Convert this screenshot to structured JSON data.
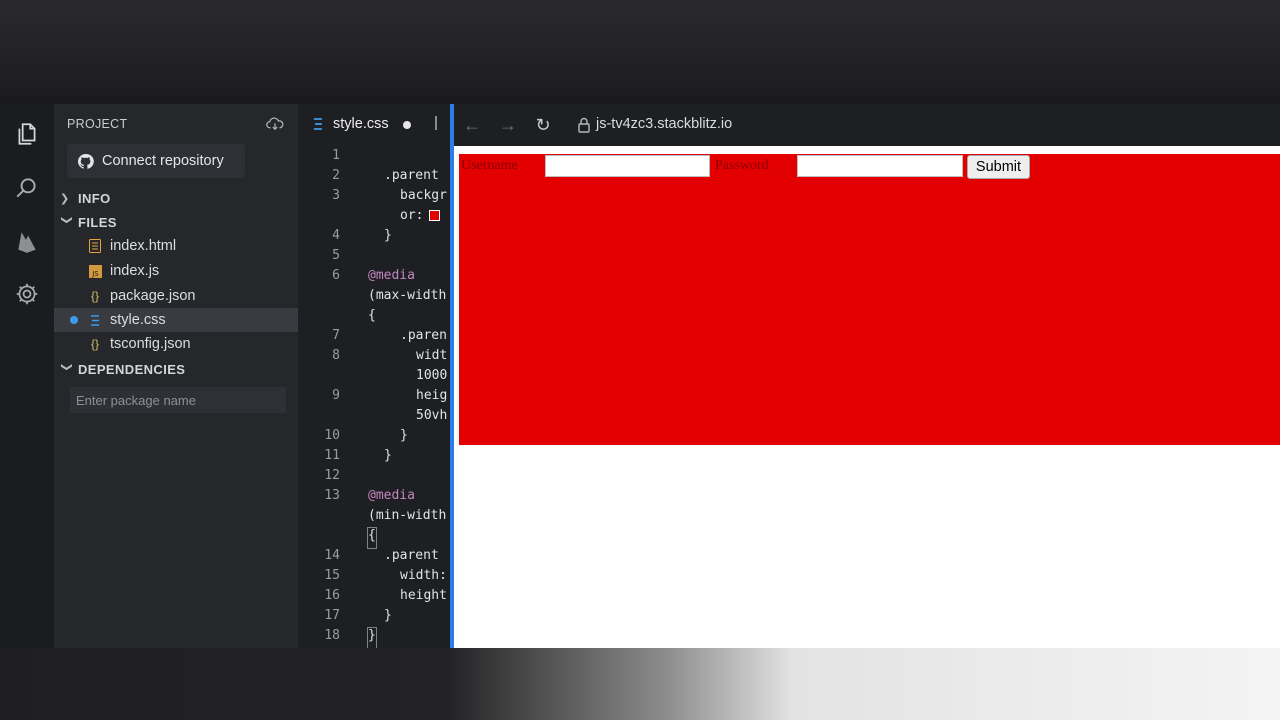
{
  "sidebar": {
    "project_title": "PROJECT",
    "connect_label": "Connect repository",
    "sections": {
      "info": "INFO",
      "files": "FILES",
      "dependencies": "DEPENDENCIES"
    },
    "files": [
      {
        "name": "index.html",
        "icon": "html-file-icon"
      },
      {
        "name": "index.js",
        "icon": "js-file-icon"
      },
      {
        "name": "package.json",
        "icon": "json-file-icon"
      },
      {
        "name": "style.css",
        "icon": "css-file-icon",
        "active": true,
        "unsaved": true
      },
      {
        "name": "tsconfig.json",
        "icon": "json-file-icon"
      }
    ],
    "package_placeholder": "Enter package name"
  },
  "editor": {
    "tab_label": "style.css",
    "line_numbers": [
      "1",
      "2",
      "3",
      "4",
      "5",
      "6",
      "7",
      "8",
      "9",
      "10",
      "11",
      "12",
      "13",
      "14",
      "15",
      "16",
      "17",
      "18"
    ],
    "code": {
      "l2": ".parent",
      "l3a": "backgr",
      "l3b": "or:",
      "l4": "}",
      "l6": "@media",
      "l6b": "(max-width",
      "l6c": "{",
      "l7": ".paren",
      "l8a": "widt",
      "l8b": "1000",
      "l9a": "heig",
      "l9b": "50vh",
      "l10": "}",
      "l11": "}",
      "l13": "@media",
      "l13b": "(min-width",
      "l13c": "{",
      "l14": ".parent",
      "l15": "width:",
      "l16": "height",
      "l17": "}",
      "l18": "}"
    },
    "swatch_color": "#e00000"
  },
  "preview": {
    "url": "js-tv4zc3.stackblitz.io",
    "form": {
      "username_label": "Username",
      "password_label": "Password",
      "submit_label": "Submit"
    },
    "parent_color": "#e30000"
  },
  "colors": {
    "accent": "#2d7de9",
    "sidebar_bg": "#26272b",
    "editor_bg": "#1e1f22"
  }
}
